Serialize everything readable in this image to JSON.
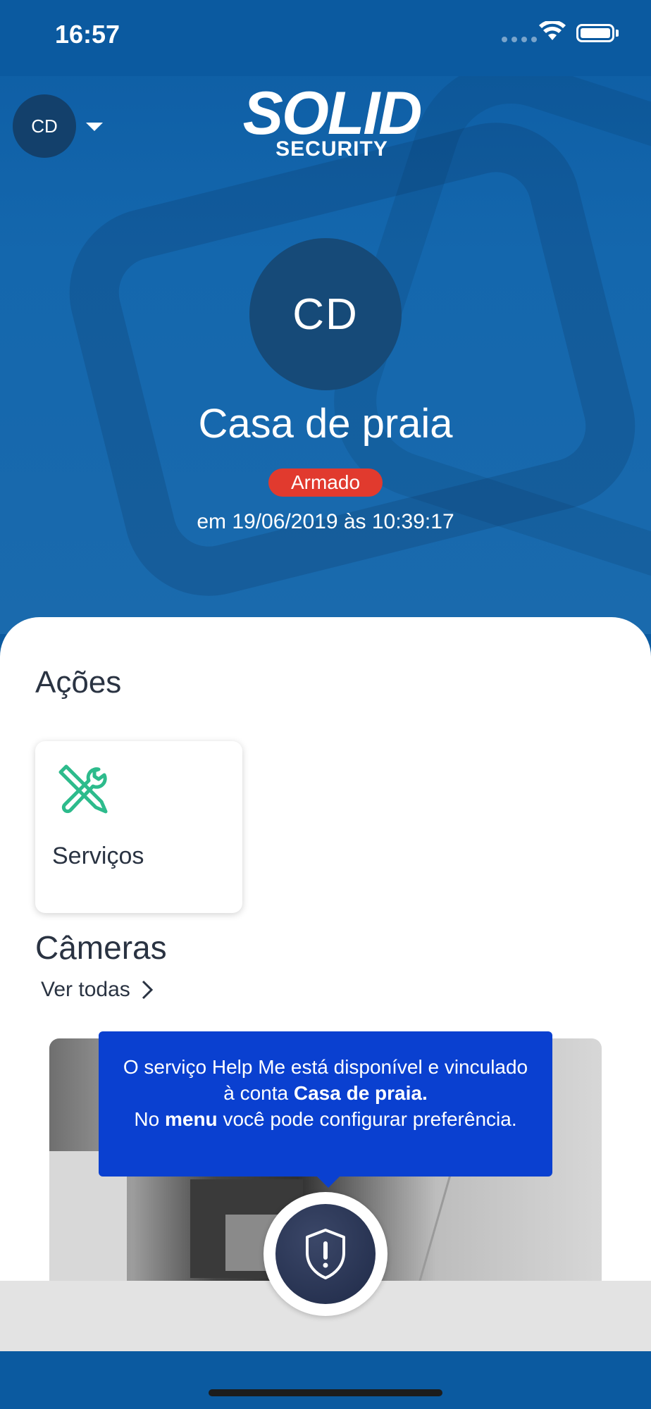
{
  "status_bar": {
    "time": "16:57"
  },
  "header": {
    "account_initials": "CD",
    "logo_main": "SOLID",
    "logo_sub": "SECURITY"
  },
  "profile": {
    "initials": "CD",
    "name": "Casa de praia",
    "status": "Armado",
    "status_color": "#e13a2e",
    "timestamp": "em 19/06/2019 às 10:39:17"
  },
  "actions": {
    "title": "Ações",
    "items": [
      {
        "label": "Serviços",
        "icon": "tools-icon",
        "color": "#2dbb8c"
      }
    ]
  },
  "cameras": {
    "title": "Câmeras",
    "see_all": "Ver todas"
  },
  "tooltip": {
    "line1": "O serviço Help Me está disponível e vinculado",
    "line2_prefix": "à conta ",
    "line2_bold": "Casa de praia.",
    "line3_prefix": "No ",
    "line3_bold": "menu",
    "line3_suffix": " você pode configurar preferência."
  },
  "fab": {
    "icon": "shield-alert-icon"
  }
}
